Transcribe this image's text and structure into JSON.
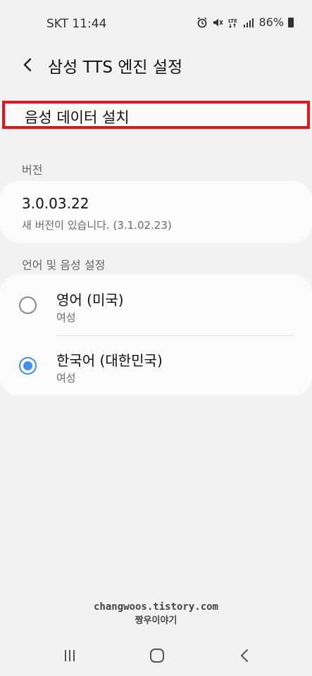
{
  "status_bar": {
    "carrier_time": "SKT 11:44",
    "battery_percent": "86%",
    "icons": [
      "alarm-icon",
      "mute-icon",
      "lte-icon",
      "signal-icon",
      "battery-icon"
    ]
  },
  "header": {
    "title": "삼성 TTS 엔진 설정",
    "back_icon": "chevron-left-icon"
  },
  "install": {
    "label": "음성 데이터 설치",
    "highlight_color": "#e6131b"
  },
  "version_section": {
    "header": "버전",
    "value": "3.0.03.22",
    "update_notice": "새 버전이 있습니다. (3.1.02.23)"
  },
  "language_section": {
    "header": "언어 및 음성 설정",
    "items": [
      {
        "name": "영어 (미국)",
        "voice": "여성",
        "selected": false
      },
      {
        "name": "한국어 (대한민국)",
        "voice": "여성",
        "selected": true
      }
    ],
    "accent_color": "#3e90e6"
  },
  "watermark": {
    "line1": "changwoos.tistory.com",
    "line2": "짱우이야기"
  },
  "nav_bar": {
    "icons": [
      "recent-apps-icon",
      "home-icon",
      "back-icon"
    ]
  }
}
